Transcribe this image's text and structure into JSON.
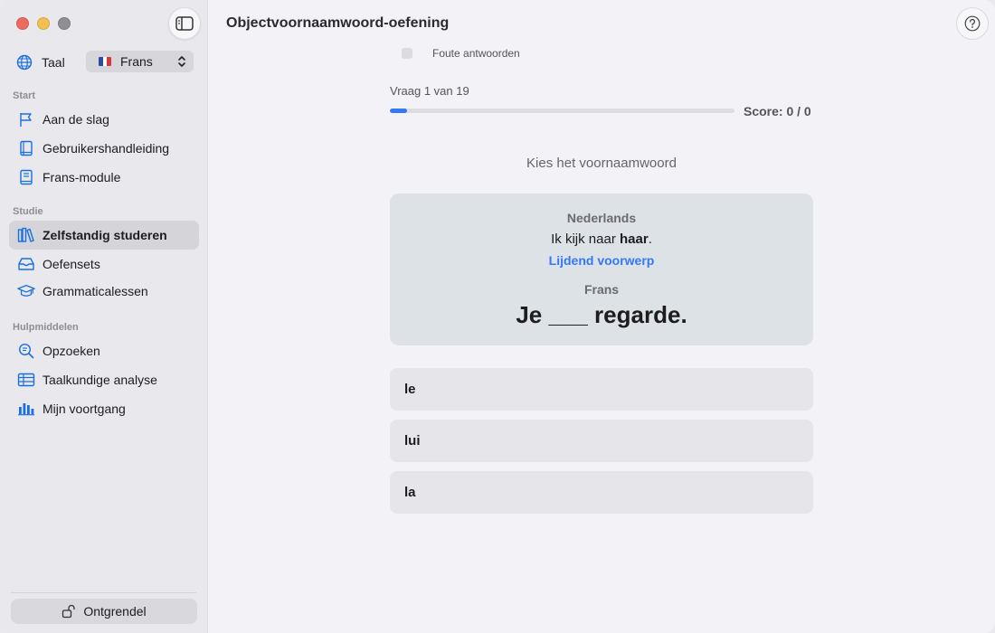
{
  "sidebar": {
    "language_label": "Taal",
    "language_selected": "Frans",
    "flag_colors": [
      "#2b4fa0",
      "#ffffff",
      "#d63a3a"
    ],
    "sections": {
      "start": "Start",
      "study": "Studie",
      "tools": "Hulpmiddelen"
    },
    "items": [
      {
        "label": "Aan de slag",
        "icon": "flag-icon"
      },
      {
        "label": "Gebruikershandleiding",
        "icon": "book-icon"
      },
      {
        "label": "Frans-module",
        "icon": "module-book-icon"
      },
      {
        "label": "Zelfstandig studeren",
        "icon": "library-icon",
        "active": true
      },
      {
        "label": "Oefensets",
        "icon": "tray-icon"
      },
      {
        "label": "Grammaticalessen",
        "icon": "graduation-cap-icon"
      },
      {
        "label": "Opzoeken",
        "icon": "text-magnify-icon"
      },
      {
        "label": "Taalkundige analyse",
        "icon": "table-icon"
      },
      {
        "label": "Mijn voortgang",
        "icon": "bar-chart-icon"
      }
    ],
    "unlock_label": "Ontgrendel"
  },
  "header": {
    "title": "Objectvoornaamwoord-oefening"
  },
  "quiz": {
    "wrong_answers_label": "Foute antwoorden",
    "question_label": "Vraag 1 van 19",
    "progress_fraction": 0.05,
    "score_label": "Score: 0 / 0",
    "prompt": "Kies het voornaamwoord",
    "source_language": "Nederlands",
    "sentence_before": "Ik kijk naar ",
    "sentence_bold": "haar",
    "sentence_after": ".",
    "grammatical_role": "Lijdend voorwerp",
    "target_language": "Frans",
    "target_sentence": "Je ___ regarde.",
    "options": [
      "le",
      "lui",
      "la"
    ]
  },
  "colors": {
    "accent": "#3478f6"
  }
}
